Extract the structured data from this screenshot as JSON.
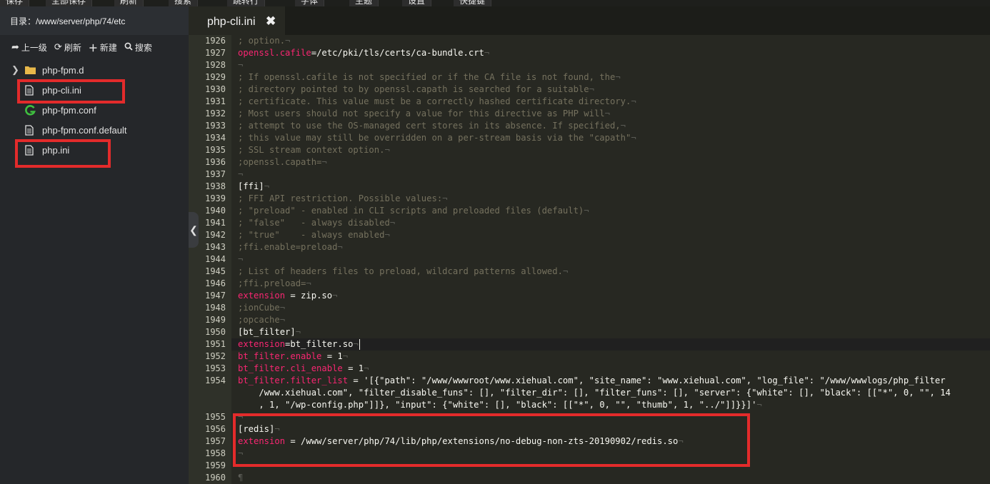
{
  "topbar": {
    "items": [
      {
        "label": "保存",
        "x_hint": "save"
      },
      {
        "label": "全部保存",
        "x_hint": "save-all"
      },
      {
        "label": "刷新",
        "x_hint": "refresh"
      },
      {
        "label": "搜索",
        "x_hint": "search"
      },
      {
        "label": "跳转行",
        "x_hint": "goto"
      },
      {
        "label": "字体",
        "x_hint": "font"
      },
      {
        "label": "主题",
        "x_hint": "theme"
      },
      {
        "label": "设置",
        "x_hint": "settings"
      },
      {
        "label": "快捷键",
        "x_hint": "shortcuts"
      }
    ]
  },
  "sidebar": {
    "directory_label": "目录：/www/server/php/74/etc",
    "toolbar": {
      "up": "上一级",
      "refresh": "刷新",
      "new": "新建",
      "search": "搜索"
    },
    "files": [
      {
        "name": "php-fpm.d",
        "type": "folder"
      },
      {
        "name": "php-cli.ini",
        "type": "file",
        "highlighted": true
      },
      {
        "name": "php-fpm.conf",
        "type": "conf"
      },
      {
        "name": "php-fpm.conf.default",
        "type": "file"
      },
      {
        "name": "php.ini",
        "type": "file",
        "highlighted": true
      }
    ]
  },
  "editor": {
    "tab_label": "php-cli.ini",
    "lines": [
      {
        "n": "1926",
        "segs": [
          [
            "cm",
            "; option."
          ],
          [
            "nv",
            "¬"
          ]
        ]
      },
      {
        "n": "1927",
        "segs": [
          [
            "ky",
            "openssl.cafile"
          ],
          [
            "pl",
            "=/etc/pki/tls/certs/ca-bundle.crt"
          ],
          [
            "nv",
            "¬"
          ]
        ]
      },
      {
        "n": "1928",
        "segs": [
          [
            "nv",
            "¬"
          ]
        ]
      },
      {
        "n": "1929",
        "segs": [
          [
            "cm",
            "; If openssl.cafile is not specified or if the CA file is not found, the"
          ],
          [
            "nv",
            "¬"
          ]
        ]
      },
      {
        "n": "1930",
        "segs": [
          [
            "cm",
            "; directory pointed to by openssl.capath is searched for a suitable"
          ],
          [
            "nv",
            "¬"
          ]
        ]
      },
      {
        "n": "1931",
        "segs": [
          [
            "cm",
            "; certificate. This value must be a correctly hashed certificate directory."
          ],
          [
            "nv",
            "¬"
          ]
        ]
      },
      {
        "n": "1932",
        "segs": [
          [
            "cm",
            "; Most users should not specify a value for this directive as PHP will"
          ],
          [
            "nv",
            "¬"
          ]
        ]
      },
      {
        "n": "1933",
        "segs": [
          [
            "cm",
            "; attempt to use the OS-managed cert stores in its absence. If specified,"
          ],
          [
            "nv",
            "¬"
          ]
        ]
      },
      {
        "n": "1934",
        "segs": [
          [
            "cm",
            "; this value may still be overridden on a per-stream basis via the \"capath\""
          ],
          [
            "nv",
            "¬"
          ]
        ]
      },
      {
        "n": "1935",
        "segs": [
          [
            "cm",
            "; SSL stream context option."
          ],
          [
            "nv",
            "¬"
          ]
        ]
      },
      {
        "n": "1936",
        "segs": [
          [
            "cm",
            ";openssl.capath="
          ],
          [
            "nv",
            "¬"
          ]
        ]
      },
      {
        "n": "1937",
        "segs": [
          [
            "nv",
            "¬"
          ]
        ]
      },
      {
        "n": "1938",
        "segs": [
          [
            "pl",
            "[ffi]"
          ],
          [
            "nv",
            "¬"
          ]
        ]
      },
      {
        "n": "1939",
        "segs": [
          [
            "cm",
            "; FFI API restriction. Possible values:"
          ],
          [
            "nv",
            "¬"
          ]
        ]
      },
      {
        "n": "1940",
        "segs": [
          [
            "cm",
            "; \"preload\" - enabled in CLI scripts and preloaded files (default)"
          ],
          [
            "nv",
            "¬"
          ]
        ]
      },
      {
        "n": "1941",
        "segs": [
          [
            "cm",
            "; \"false\"   - always disabled"
          ],
          [
            "nv",
            "¬"
          ]
        ]
      },
      {
        "n": "1942",
        "segs": [
          [
            "cm",
            "; \"true\"    - always enabled"
          ],
          [
            "nv",
            "¬"
          ]
        ]
      },
      {
        "n": "1943",
        "segs": [
          [
            "cm",
            ";ffi.enable=preload"
          ],
          [
            "nv",
            "¬"
          ]
        ]
      },
      {
        "n": "1944",
        "segs": [
          [
            "nv",
            "¬"
          ]
        ]
      },
      {
        "n": "1945",
        "segs": [
          [
            "cm",
            "; List of headers files to preload, wildcard patterns allowed."
          ],
          [
            "nv",
            "¬"
          ]
        ]
      },
      {
        "n": "1946",
        "segs": [
          [
            "cm",
            ";ffi.preload="
          ],
          [
            "nv",
            "¬"
          ]
        ]
      },
      {
        "n": "1947",
        "segs": [
          [
            "ky",
            "extension"
          ],
          [
            "pl",
            " = zip.so"
          ],
          [
            "nv",
            "¬"
          ]
        ]
      },
      {
        "n": "1948",
        "segs": [
          [
            "cm",
            ";ionCube"
          ],
          [
            "nv",
            "¬"
          ]
        ]
      },
      {
        "n": "1949",
        "segs": [
          [
            "cm",
            ";opcache"
          ],
          [
            "nv",
            "¬"
          ]
        ]
      },
      {
        "n": "1950",
        "segs": [
          [
            "pl",
            "[bt_filter]"
          ],
          [
            "nv",
            "¬"
          ]
        ]
      },
      {
        "n": "1951",
        "segs": [
          [
            "ky",
            "extension"
          ],
          [
            "pl",
            "=bt_filter.so"
          ],
          [
            "nv",
            "¬"
          ]
        ]
      },
      {
        "n": "1952",
        "segs": [
          [
            "ky",
            "bt_filter.enable"
          ],
          [
            "pl",
            " = 1"
          ],
          [
            "nv",
            "¬"
          ]
        ]
      },
      {
        "n": "1953",
        "segs": [
          [
            "ky",
            "bt_filter.cli_enable"
          ],
          [
            "pl",
            " = 1"
          ],
          [
            "nv",
            "¬"
          ]
        ]
      },
      {
        "n": "1954",
        "segs": [
          [
            "ky",
            "bt_filter.filter_list"
          ],
          [
            "pl",
            " = '[{\"path\": \"/www/wwwroot/www.xiehual.com\", \"site_name\": \"www.xiehual.com\", \"log_file\": \"/www/wwwlogs/php_filter"
          ]
        ]
      },
      {
        "n": "",
        "segs": [
          [
            "pl",
            "    /www.xiehual.com\", \"filter_disable_funs\": [], \"filter_dir\": [], \"filter_funs\": [], \"server\": {\"white\": [], \"black\": [[\"*\", 0, \"\", 14"
          ]
        ]
      },
      {
        "n": "",
        "segs": [
          [
            "pl",
            "    , 1, \"/wp-config.php\"]]}, \"input\": {\"white\": [], \"black\": [[\"*\", 0, \"\", \"thumb\", 1, \"../\"]]}}]'"
          ],
          [
            "nv",
            "¬"
          ]
        ]
      },
      {
        "n": "1955",
        "segs": [
          [
            "nv",
            "¬"
          ]
        ]
      },
      {
        "n": "1956",
        "segs": [
          [
            "pl",
            "[redis]"
          ],
          [
            "nv",
            "¬"
          ]
        ]
      },
      {
        "n": "1957",
        "segs": [
          [
            "ky",
            "extension"
          ],
          [
            "pl",
            " = /www/server/php/74/lib/php/extensions/no-debug-non-zts-20190902/redis.so"
          ],
          [
            "nv",
            "¬"
          ]
        ]
      },
      {
        "n": "1958",
        "segs": [
          [
            "nv",
            "¬"
          ]
        ]
      },
      {
        "n": "1959",
        "segs": [
          [
            "nv",
            "¬"
          ]
        ]
      },
      {
        "n": "1960",
        "segs": [
          [
            "nv",
            "¶"
          ]
        ]
      }
    ]
  }
}
